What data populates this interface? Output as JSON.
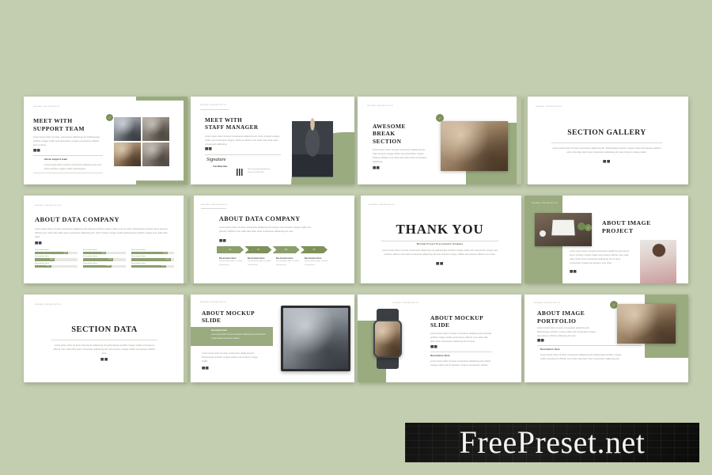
{
  "background_color": "#c3cdaf",
  "accent_color": "#8b9e6c",
  "accent_dark": "#7d9159",
  "watermark": {
    "text": "FreePreset.net"
  },
  "deck": {
    "columns": 4,
    "rows": 3,
    "slides": [
      {
        "id": "meet-with-support-team",
        "tag": "Minimal Presentation",
        "title_lines": [
          "MEET WITH",
          "SUPPORT TEAM"
        ],
        "body": "Lorem ipsum dolor sit amet, consectetur adipiscing elit. Pellentesque porttitor congue mattis sed consectetur congue sed posuere efficitur eros et lorem.",
        "dots": "⬛⬛",
        "sub_title": "About support team",
        "sub_body": "Lorem ipsum dolor sit amet consectetur adipiscing elit cras ipsum porttitor congue mattis pellentesque.",
        "photo_count": 4,
        "badge": "✓"
      },
      {
        "id": "meet-with-staff-manager",
        "tag": "Minimal Presentation",
        "title_lines": [
          "MEET WITH",
          "STAFF MANAGER"
        ],
        "body": "Lorem ipsum dolor sit amet consectetur adipiscing elit. Cras id ipsum congue, mattis sed consectetur congue. Posuere efficitur eros nulla vitae dolor amet consectetur adipiscing.",
        "dots": "⬛⬛",
        "signature": "Signature",
        "signature_name": "Your Name Here",
        "contact_label_1": "Email",
        "contact_value_1": "yourmail@company.com",
        "contact_label_2": "Phone",
        "contact_value_2": "+00 1234 5678",
        "qr_label": "qr-code"
      },
      {
        "id": "awesome-break-section",
        "tag": "Minimal Presentation",
        "title_lines": [
          "AWESOME",
          "BREAK",
          "SECTION"
        ],
        "body": "Lorem ipsum dolor sit amet consectetur adipiscing elit. Cras id ipsum congue mattis sed consectetur congue. Posuere efficitur eros nulla vitae dolor amet consectetur adipiscing.",
        "dots": "⬛⬛",
        "badge": "✓"
      },
      {
        "id": "section-gallery",
        "tag": "Minimal Presentation",
        "title_lines": [
          "SECTION GALLERY"
        ],
        "body": "Lorem ipsum dolor sit amet consectetur adipiscing elit. Pellentesque porttitor congue mattis sed posuere efficitur eros nulla vitae dolor amet consectetur adipiscing elit cras id ipsum congue mattis.",
        "dots": "⬛⬛"
      },
      {
        "id": "about-data-company-bars",
        "tag": "Minimal Presentation",
        "title_lines": [
          "ABOUT DATA COMPANY"
        ],
        "body": "Lorem ipsum dolor sit amet consectetur adipiscing elit molestie porttitor congue mattis cras sit nulla. Pellentesque porttitor lorem posuere efficitur eros nulla vitae dolor amet consectetur adipiscing elit. Cras id ipsum congue mattis pellentesque porttitor congue eros nulla vitae dolor.",
        "dots": "⬛⬛",
        "bars": [
          {
            "label": "Description Here",
            "value": 78
          },
          {
            "label": "Description Here",
            "value": 54
          },
          {
            "label": "Description Here",
            "value": 86
          },
          {
            "label": "Description Here",
            "value": 46
          },
          {
            "label": "Description Here",
            "value": 70
          },
          {
            "label": "Description Here",
            "value": 92
          },
          {
            "label": "Description Here",
            "value": 38
          },
          {
            "label": "Description Here",
            "value": 66
          },
          {
            "label": "Description Here",
            "value": 82
          }
        ]
      },
      {
        "id": "about-data-company-steps",
        "tag": "Minimal Presentation",
        "title_lines": [
          "ABOUT DATA COMPANY"
        ],
        "body": "Lorem ipsum dolor sit amet consectetur adipiscing elit congue cras id ipsum congue mattis sed posuere. Efficitur eros nulla vitae dolor amet consectetur adipiscing elit cras.",
        "dots": "⬛⬛",
        "steps": [
          {
            "number": "01",
            "title": "Description Here",
            "text": "Lorem ipsum dolor sit amet consectetur."
          },
          {
            "number": "02",
            "title": "Description Here",
            "text": "Lorem ipsum dolor sit amet consectetur."
          },
          {
            "number": "03",
            "title": "Description Here",
            "text": "Lorem ipsum dolor sit amet consectetur."
          },
          {
            "number": "04",
            "title": "Description Here",
            "text": "Lorem ipsum dolor sit amet consectetur."
          }
        ]
      },
      {
        "id": "thank-you",
        "tag": "Minimal Presentation",
        "title_lines": [
          "THANK YOU"
        ],
        "subtitle": "Minimal Project Presentation Template",
        "body": "Lorem ipsum dolor sit amet consectetur adipiscing elit pellentesque porttitor congue mattis sed consectetur congue sed posuere efficitur eros nulla consectetur adipiscing elit cras id ipsum congue. Mattis sed posuere efficitur eros nulla.",
        "dots": "⬛⬛"
      },
      {
        "id": "about-image-project",
        "tag": "Minimal Presentation",
        "title_lines": [
          "ABOUT IMAGE",
          "PROJECT"
        ],
        "body": "Lorem ipsum dolor sit amet consectetur adipiscing elit cras id ipsum porttitor congue mattis sed posuere efficitur eros nulla vitae. Dolor amet consectetur adipiscing elit sit amet consectetur congue sed posuere eros nulla.",
        "dots": "⬛⬛",
        "badge": "✓"
      },
      {
        "id": "section-data",
        "tag": "Minimal Presentation",
        "title_lines": [
          "SECTION DATA"
        ],
        "body": "Lorem ipsum dolor sit amet consectetur adipiscing elit pellentesque porttitor congue mattis sed posuere efficitur eros nulla vitae dolor consectetur adipiscing elit cras id ipsum congue mattis sed posuere efficitur eros.",
        "dots": "⬛⬛"
      },
      {
        "id": "about-mockup-slide-tablet",
        "tag": "Minimal Presentation",
        "title_lines": [
          "ABOUT MOCKUP",
          "SLIDE"
        ],
        "callout_title": "Description Here",
        "callout_body": "Lorem ipsum dolor sit amet consectetur adipiscing elit cras id ipsum congue mattis sed posuere efficitur.",
        "body": "Lorem ipsum dolor sit amet consectetur adipiscing elit. Pellentesque porttitor congue mattis cras id ipsum congue mattis.",
        "dots": "⬛⬛"
      },
      {
        "id": "about-mockup-slide-watch",
        "tag": "Minimal Presentation",
        "title_lines": [
          "ABOUT MOCKUP",
          "SLIDE"
        ],
        "body": "Lorem ipsum dolor sit amet consectetur adipiscing elit molestie porttitor congue mattis sed posuere efficitur eros nulla vitae dolor amet consectetur adipiscing elit sit amet.",
        "dots": "⬛⬛",
        "sub_title": "Description Here",
        "sub_body": "Lorem ipsum dolor sit amet consectetur adipiscing elit porttitor congue mattis sed consectetur congue sed posuere efficitur."
      },
      {
        "id": "about-image-portfolio",
        "tag": "Minimal Presentation",
        "title_lines": [
          "ABOUT IMAGE",
          "PORTFOLIO"
        ],
        "body": "Lorem ipsum dolor sit amet consectetur adipiscing elit. Pellentesque porttitor congue mattis sed consectetur congue sed posuere efficitur adipiscing elit cras.",
        "dots": "⬛⬛",
        "sub_title": "Description Here",
        "sub_body": "Lorem ipsum dolor sit amet consectetur adipiscing elit pellentesque porttitor congue mattis sed posuere efficitur eros nulla vitae dolor amet consectetur adipiscing elit.",
        "badge": "✓"
      }
    ]
  }
}
